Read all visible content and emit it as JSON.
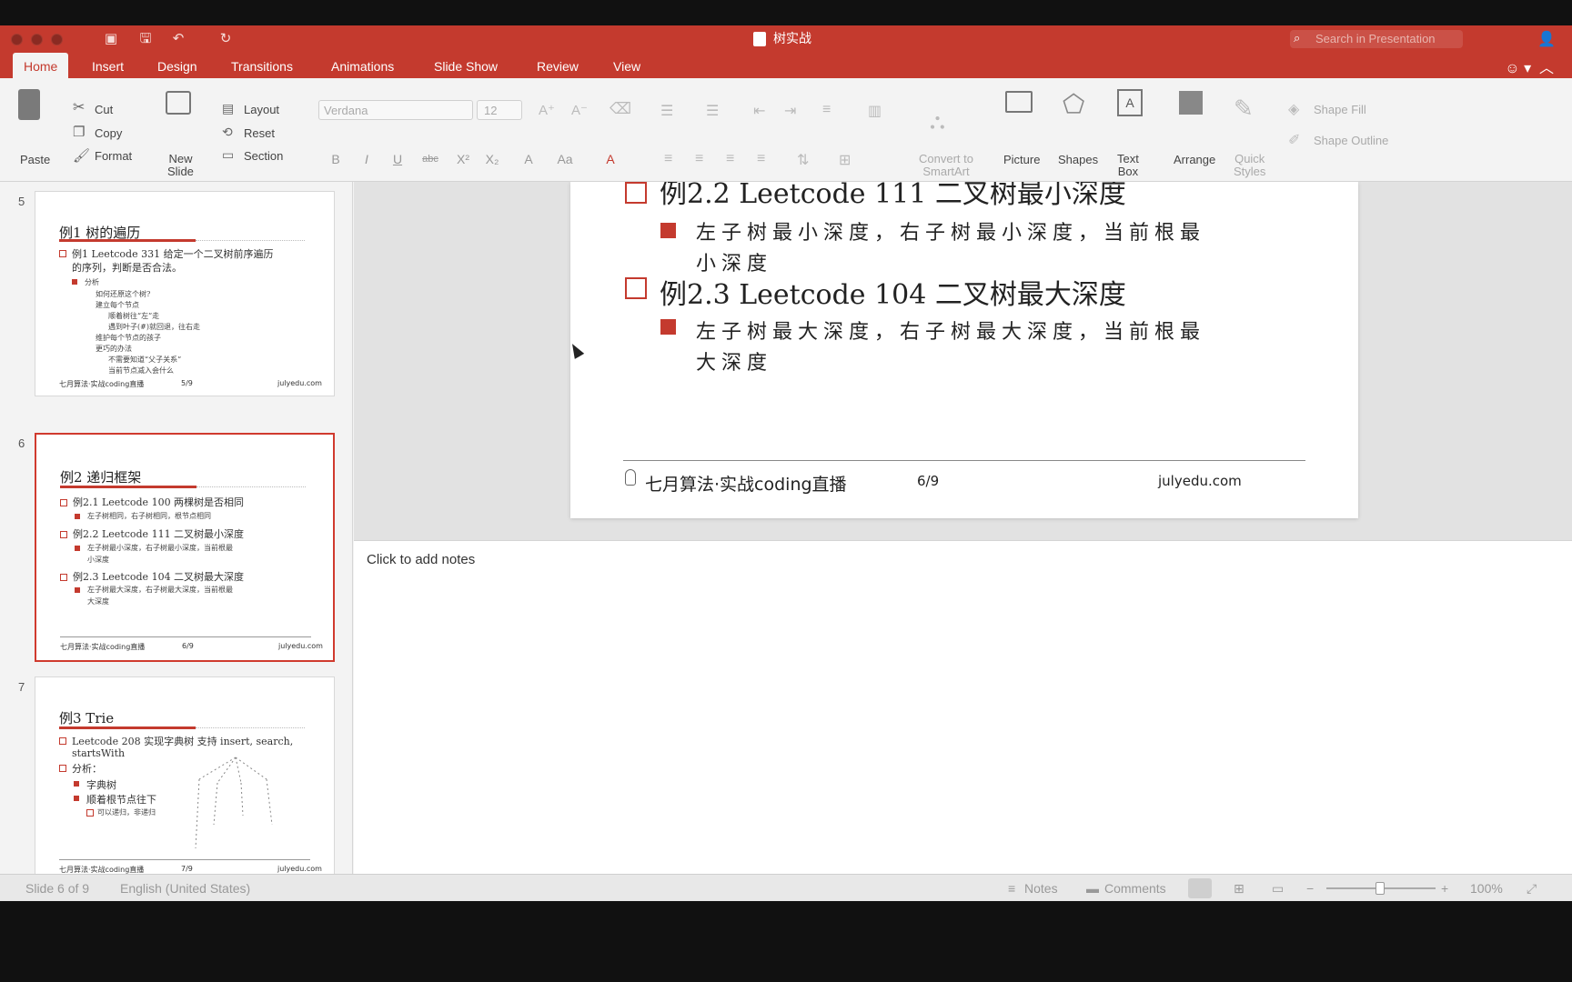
{
  "app": {
    "document_title": "树实战",
    "search_placeholder": "Search in Presentation"
  },
  "tabs": [
    "Home",
    "Insert",
    "Design",
    "Transitions",
    "Animations",
    "Slide Show",
    "Review",
    "View"
  ],
  "ribbon": {
    "paste": "Paste",
    "cut": "Cut",
    "copy": "Copy",
    "format": "Format",
    "new_slide_1": "New",
    "new_slide_2": "Slide",
    "layout": "Layout",
    "reset": "Reset",
    "section": "Section",
    "font_name": "Verdana",
    "font_size": "12",
    "convert_1": "Convert to",
    "convert_2": "SmartArt",
    "picture": "Picture",
    "shapes": "Shapes",
    "text_box_1": "Text",
    "text_box_2": "Box",
    "arrange": "Arrange",
    "quick_styles_1": "Quick",
    "quick_styles_2": "Styles",
    "shape_fill": "Shape Fill",
    "shape_outline": "Shape Outline"
  },
  "thumbnails": [
    {
      "number": "5",
      "title": "例1 树的遍历",
      "lines": [
        "例1 Leetcode 331 给定一个二叉树前序遍历",
        "的序列，判断是否合法。",
        "分析",
        "如何还原这个树?",
        "建立每个节点",
        "顺着树往“左”走",
        "遇到叶子(#)就回退，往右走",
        "维护每个节点的孩子",
        "更巧的办法",
        "不需要知道“父子关系”",
        "当前节点减入会什么"
      ],
      "footer_left": "七月算法·实战coding直播",
      "footer_mid": "5/9",
      "footer_right": "julyedu.com"
    },
    {
      "number": "6",
      "title": "例2 递归框架",
      "lines": [
        "例2.1 Leetcode 100 两棵树是否相同",
        "左子树相同，右子树相同，根节点相同",
        "例2.2 Leetcode 111 二叉树最小深度",
        "左子树最小深度，右子树最小深度，当前根最",
        "小深度",
        "例2.3 Leetcode 104 二叉树最大深度",
        "左子树最大深度，右子树最大深度，当前根最",
        "大深度"
      ],
      "footer_left": "七月算法·实战coding直播",
      "footer_mid": "6/9",
      "footer_right": "julyedu.com"
    },
    {
      "number": "7",
      "title": "例3 Trie",
      "lines": [
        "Leetcode 208 实现字典树 支持 insert, search,",
        "startsWith",
        "分析：",
        "字典树",
        "顺着根节点往下",
        "可以递归，非递归"
      ],
      "footer_left": "七月算法·实战coding直播",
      "footer_mid": "7/9",
      "footer_right": "julyedu.com"
    }
  ],
  "slide": {
    "heading_2_2": "例2.2 Leetcode 111 二叉树最小深度",
    "body_2_2_line1": "左子树最小深度，右子树最小深度，当前根最",
    "body_2_2_line2": "小深度",
    "heading_2_3": "例2.3 Leetcode 104 二叉树最大深度",
    "body_2_3_line1": "左子树最大深度，右子树最大深度，当前根最",
    "body_2_3_line2": "大深度",
    "footer_left": "七月算法·实战coding直播",
    "footer_mid": "6/9",
    "footer_right": "julyedu.com"
  },
  "notes": {
    "placeholder": "Click to add notes"
  },
  "statusbar": {
    "slide_info": "Slide 6 of 9",
    "language": "English (United States)",
    "notes": "Notes",
    "comments": "Comments",
    "zoom": "100%"
  },
  "colors": {
    "accent": "#c43a2e",
    "background": "#f3f3f3"
  },
  "icons": [
    "close-icon",
    "minimize-icon",
    "zoom-icon",
    "sidebar-icon",
    "save-icon",
    "undo-icon",
    "redo-icon",
    "document-icon",
    "search-icon",
    "add-person-icon",
    "smiley-icon",
    "collapse-icon",
    "paste-icon",
    "cut-icon",
    "copy-icon",
    "format-painter-icon",
    "new-slide-icon",
    "layout-icon",
    "reset-icon",
    "section-icon",
    "picture-icon",
    "shapes-icon",
    "text-box-icon",
    "arrange-icon",
    "quick-styles-icon",
    "shape-fill-icon",
    "shape-outline-icon",
    "bulb-icon"
  ]
}
